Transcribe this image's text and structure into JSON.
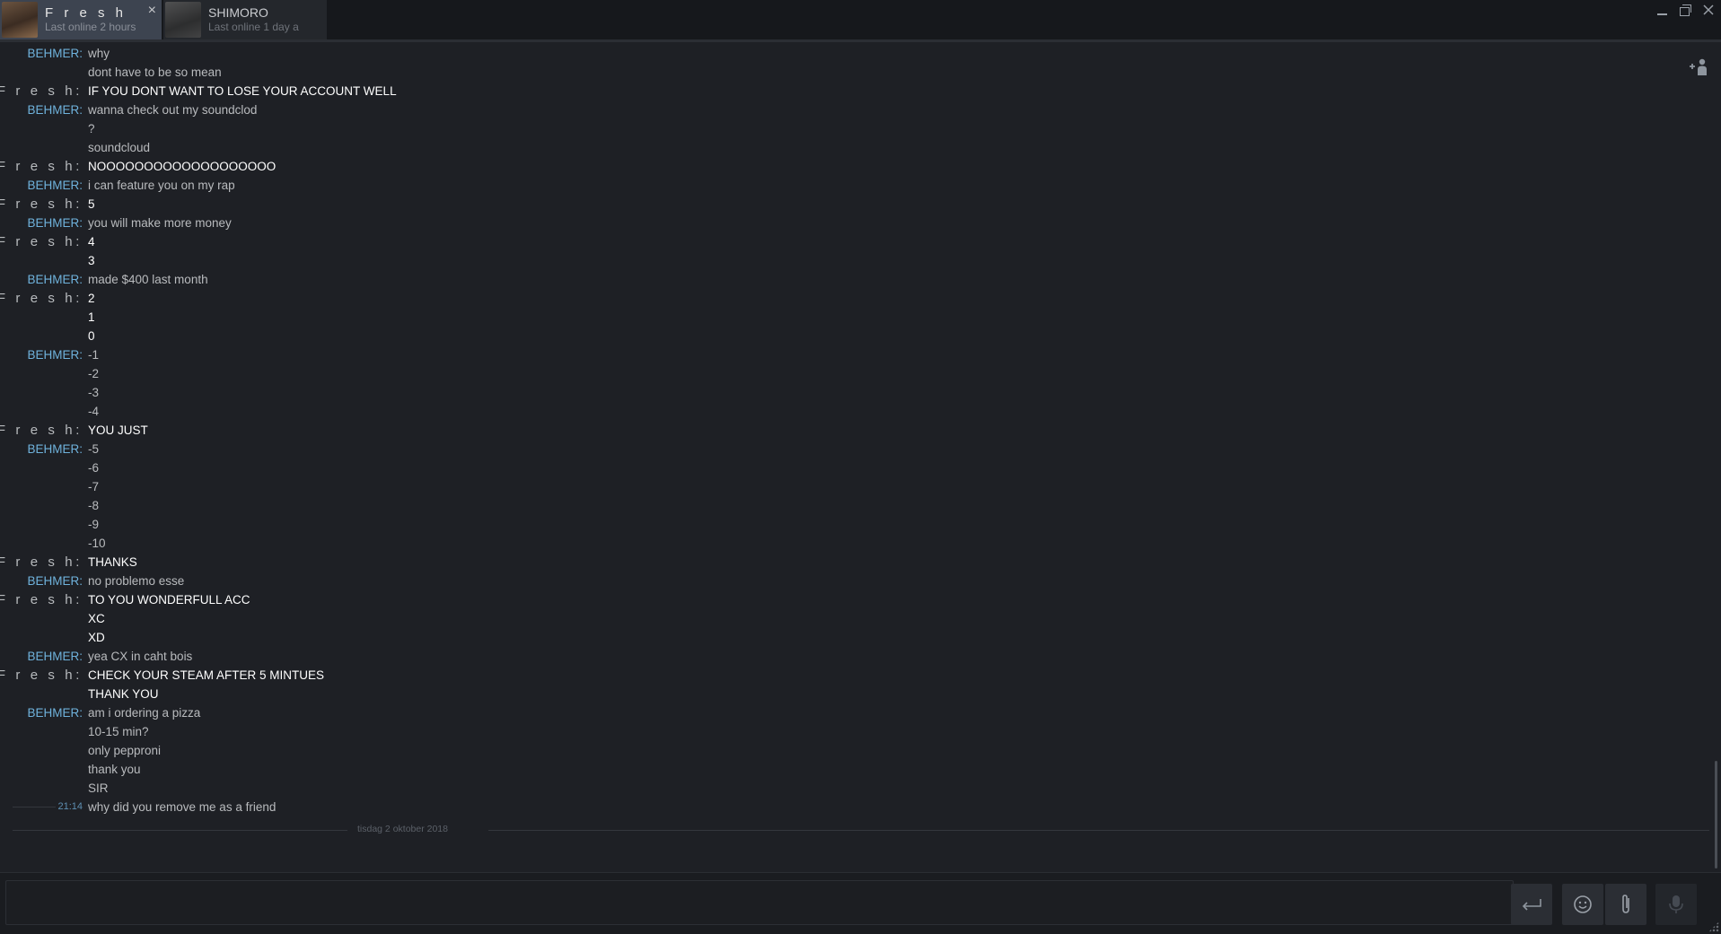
{
  "tabs": [
    {
      "name": "F r e s h",
      "status": "Last online 2 hours"
    },
    {
      "name": "SHIMORO",
      "status": "Last online 1 day a"
    }
  ],
  "window": {
    "close_tab": "×"
  },
  "messages": [
    {
      "sender": "BEHMER:",
      "role": "behmer",
      "text": "why"
    },
    {
      "sender": "",
      "role": "behmer",
      "text": "dont have to be so mean"
    },
    {
      "sender": "F r e s h:",
      "role": "fresh",
      "text": "IF YOU DONT WANT TO LOSE YOUR ACCOUNT WELL"
    },
    {
      "sender": "BEHMER:",
      "role": "behmer",
      "text": "wanna check out my soundclod"
    },
    {
      "sender": "",
      "role": "behmer",
      "text": "?"
    },
    {
      "sender": "",
      "role": "behmer",
      "text": "soundcloud"
    },
    {
      "sender": "F r e s h:",
      "role": "fresh",
      "text": "NOOOOOOOOOOOOOOOOOOO"
    },
    {
      "sender": "BEHMER:",
      "role": "behmer",
      "text": "i can feature you on my rap"
    },
    {
      "sender": "F r e s h:",
      "role": "fresh",
      "text": "5"
    },
    {
      "sender": "BEHMER:",
      "role": "behmer",
      "text": "you will make more money"
    },
    {
      "sender": "F r e s h:",
      "role": "fresh",
      "text": "4"
    },
    {
      "sender": "",
      "role": "fresh",
      "text": "3"
    },
    {
      "sender": "BEHMER:",
      "role": "behmer",
      "text": "made $400 last month"
    },
    {
      "sender": "F r e s h:",
      "role": "fresh",
      "text": "2"
    },
    {
      "sender": "",
      "role": "fresh",
      "text": "1"
    },
    {
      "sender": "",
      "role": "fresh",
      "text": "0"
    },
    {
      "sender": "BEHMER:",
      "role": "behmer",
      "text": "-1"
    },
    {
      "sender": "",
      "role": "behmer",
      "text": "-2"
    },
    {
      "sender": "",
      "role": "behmer",
      "text": "-3"
    },
    {
      "sender": "",
      "role": "behmer",
      "text": "-4"
    },
    {
      "sender": "F r e s h:",
      "role": "fresh",
      "text": "YOU JUST"
    },
    {
      "sender": "BEHMER:",
      "role": "behmer",
      "text": "-5"
    },
    {
      "sender": "",
      "role": "behmer",
      "text": "-6"
    },
    {
      "sender": "",
      "role": "behmer",
      "text": "-7"
    },
    {
      "sender": "",
      "role": "behmer",
      "text": "-8"
    },
    {
      "sender": "",
      "role": "behmer",
      "text": "-9"
    },
    {
      "sender": "",
      "role": "behmer",
      "text": "-10"
    },
    {
      "sender": "F r e s h:",
      "role": "fresh",
      "text": "THANKS"
    },
    {
      "sender": "BEHMER:",
      "role": "behmer",
      "text": "no problemo esse"
    },
    {
      "sender": "F r e s h:",
      "role": "fresh",
      "text": "TO YOU WONDERFULL ACC"
    },
    {
      "sender": "",
      "role": "fresh",
      "text": "XC"
    },
    {
      "sender": "",
      "role": "fresh",
      "text": "XD"
    },
    {
      "sender": "BEHMER:",
      "role": "behmer",
      "text": "yea CX in caht bois"
    },
    {
      "sender": "F r e s h:",
      "role": "fresh",
      "text": "CHECK YOUR STEAM AFTER 5 MINTUES"
    },
    {
      "sender": "",
      "role": "fresh",
      "text": "THANK YOU"
    },
    {
      "sender": "BEHMER:",
      "role": "behmer",
      "text": "am i ordering a pizza"
    },
    {
      "sender": "",
      "role": "behmer",
      "text": "10-15 min?"
    },
    {
      "sender": "",
      "role": "behmer",
      "text": "only pepproni"
    },
    {
      "sender": "",
      "role": "behmer",
      "text": "thank you"
    },
    {
      "sender": "",
      "role": "behmer",
      "text": "SIR"
    },
    {
      "sender": "21:14",
      "role": "time",
      "text": "why did you remove me as a friend"
    }
  ],
  "date_separator": "tisdag 2 oktober 2018",
  "input": {
    "value": "",
    "placeholder": ""
  },
  "icons": {
    "add_friend": "add-friend-icon",
    "send": "send-icon",
    "emoji": "emoji-icon",
    "attach": "paperclip-icon",
    "voice": "microphone-icon"
  }
}
